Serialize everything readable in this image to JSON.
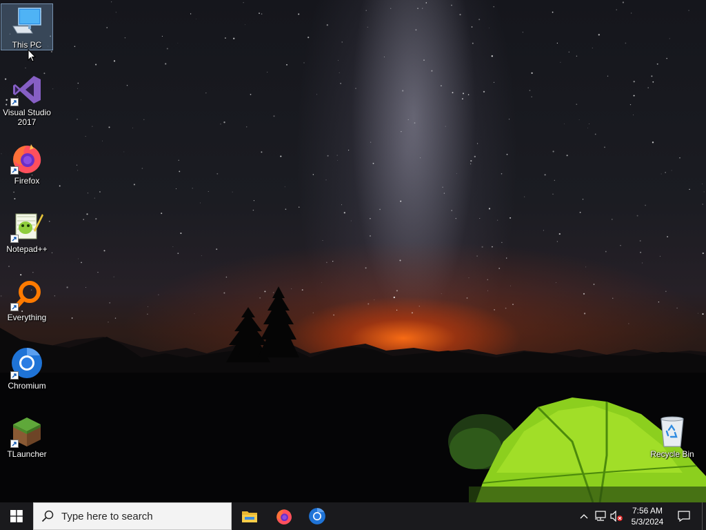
{
  "desktop": {
    "icons": [
      {
        "label": "This PC",
        "icon": "computer-icon",
        "selected": true
      },
      {
        "label": "Visual Studio 2017",
        "icon": "visual-studio-icon",
        "shortcut": true
      },
      {
        "label": "Firefox",
        "icon": "firefox-icon",
        "shortcut": true
      },
      {
        "label": "Notepad++",
        "icon": "notepad-plus-plus-icon",
        "shortcut": true
      },
      {
        "label": "Everything",
        "icon": "everything-search-icon",
        "shortcut": true
      },
      {
        "label": "Chromium",
        "icon": "chromium-icon",
        "shortcut": true
      },
      {
        "label": "TLauncher",
        "icon": "tlauncher-icon",
        "shortcut": true
      }
    ],
    "recycle_bin": {
      "label": "Recycle Bin",
      "icon": "recycle-bin-icon"
    }
  },
  "taskbar": {
    "start_icon": "windows-logo-icon",
    "search": {
      "placeholder": "Type here to search",
      "icon": "search-icon"
    },
    "pinned_apps": [
      {
        "name": "File Explorer",
        "icon": "folder-icon"
      },
      {
        "name": "Firefox",
        "icon": "firefox-icon"
      },
      {
        "name": "Chromium",
        "icon": "chromium-icon"
      }
    ],
    "tray": {
      "chevron_icon": "chevron-up-icon",
      "network_icon": "network-icon",
      "volume_icon": "volume-muted-icon"
    },
    "clock": {
      "time": "7:56 AM",
      "date": "5/3/2024"
    },
    "notification_icon": "action-center-icon"
  },
  "colors": {
    "taskbar": "#1a1a1d",
    "search_box": "#f3f3f3",
    "windows_accent": "#ffffff"
  }
}
